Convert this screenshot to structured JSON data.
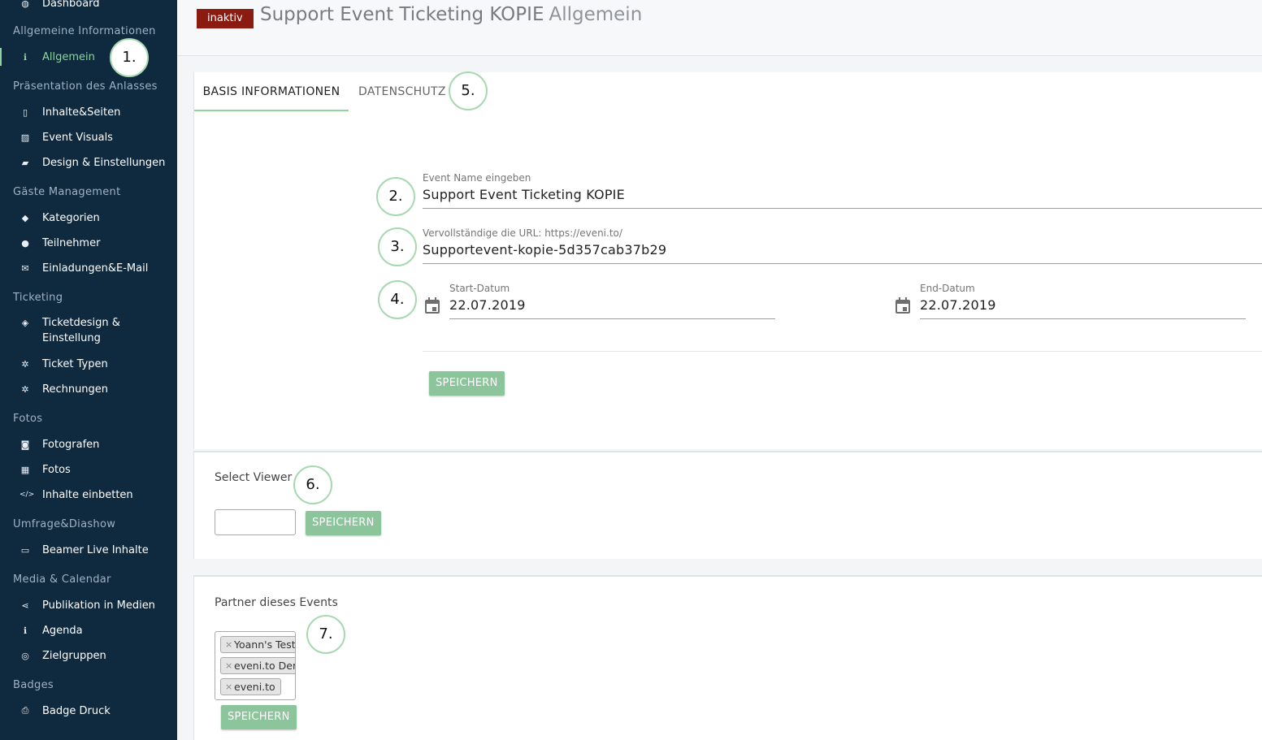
{
  "sidebar": {
    "items": [
      {
        "label": "Dashboard",
        "icon": "dashboard-icon",
        "glyph": "◍"
      },
      {
        "label": "Allgemein",
        "icon": "info-icon",
        "glyph": "ℹ"
      },
      {
        "label": "Inhalte&Seiten",
        "icon": "file-icon",
        "glyph": "▯"
      },
      {
        "label": "Event Visuals",
        "icon": "image-file-icon",
        "glyph": "▨"
      },
      {
        "label": "Design & Einstellungen",
        "icon": "book-icon",
        "glyph": "▰"
      },
      {
        "label": "Kategorien",
        "icon": "tags-icon",
        "glyph": "◆"
      },
      {
        "label": "Teilnehmer",
        "icon": "users-icon",
        "glyph": "●"
      },
      {
        "label": "Einladungen&E-Mail",
        "icon": "envelope-icon",
        "glyph": "✉"
      },
      {
        "label": "Ticketdesign & Einstellung",
        "icon": "ticket-icon",
        "glyph": "◈"
      },
      {
        "label": "Ticket Typen",
        "icon": "cogs-icon",
        "glyph": "✲"
      },
      {
        "label": "Rechnungen",
        "icon": "cogs-icon",
        "glyph": "✲"
      },
      {
        "label": "Fotografen",
        "icon": "camera-icon",
        "glyph": "◙"
      },
      {
        "label": "Fotos",
        "icon": "film-icon",
        "glyph": "▦"
      },
      {
        "label": "Inhalte einbetten",
        "icon": "code-icon",
        "glyph": "</>"
      },
      {
        "label": "Beamer Live Inhalte",
        "icon": "desktop-icon",
        "glyph": "▭"
      },
      {
        "label": "Publikation in Medien",
        "icon": "share-icon",
        "glyph": "⋖"
      },
      {
        "label": "Agenda",
        "icon": "info-icon",
        "glyph": "ℹ"
      },
      {
        "label": "Zielgruppen",
        "icon": "target-icon",
        "glyph": "◎"
      },
      {
        "label": "Badge Druck",
        "icon": "print-icon",
        "glyph": "⎙"
      }
    ],
    "sections": [
      "Allgemeine Informationen",
      "Präsentation des Anlasses",
      "Gäste Management",
      "Ticketing",
      "Fotos",
      "Umfrage&Diashow",
      "Media & Calendar",
      "Badges"
    ]
  },
  "header": {
    "status_badge": "inaktiv",
    "title": "Support Event Ticketing KOPIE",
    "subtitle": "Allgemein"
  },
  "tabs": [
    {
      "label": "BASIS INFORMATIONEN",
      "active": true
    },
    {
      "label": "DATENSCHUTZ",
      "active": false
    }
  ],
  "form": {
    "event_name_label": "Event Name eingeben",
    "event_name_value": "Support Event Ticketing KOPIE",
    "url_label": "Vervollständige die URL: https://eveni.to/",
    "url_value": "Supportevent-kopie-5d357cab37b29",
    "start_label": "Start-Datum",
    "start_value": "22.07.2019",
    "end_label": "End-Datum",
    "end_value": "22.07.2019",
    "save_label": "SPEICHERN"
  },
  "viewer": {
    "label": "Select Viewer",
    "input_value": "",
    "save_label": "SPEICHERN"
  },
  "partner": {
    "label": "Partner dieses Events",
    "chips": [
      "Yoann's Test",
      "eveni.to Der",
      "eveni.to"
    ],
    "chip_remove": "×",
    "save_label": "SPEICHERN"
  },
  "annotations": [
    "1.",
    "2.",
    "3.",
    "4.",
    "5.",
    "6.",
    "7."
  ],
  "colors": {
    "sidebar_bg": "#0f2a3f",
    "accent_green": "#8fd39f",
    "button_green": "#8cc59b",
    "badge_red": "#8b1a10"
  }
}
